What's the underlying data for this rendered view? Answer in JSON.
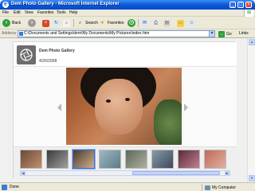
{
  "window": {
    "title": "Dem Photo Gallery - Microsoft Internet Explorer"
  },
  "menu": [
    {
      "label": "File"
    },
    {
      "label": "Edit"
    },
    {
      "label": "View"
    },
    {
      "label": "Favorites"
    },
    {
      "label": "Tools"
    },
    {
      "label": "Help"
    }
  ],
  "toolbar": {
    "back_label": "Back",
    "search_label": "Search",
    "favorites_label": "Favorites"
  },
  "address": {
    "label": "Address",
    "value": "C:\\Documents and Settings\\dem\\My Documents\\My Pictures\\index.htm",
    "go_label": "Go",
    "links_label": "Links"
  },
  "gallery": {
    "title": "Dem Photo Gallery",
    "date": "4/26/2008",
    "thumb_count_visible": 8,
    "selected_thumb": 3
  },
  "status": {
    "text": "Done",
    "zone": "My Computer"
  },
  "colors": {
    "title_bar": "#0a5bd8",
    "chrome": "#ece9d8",
    "accent": "#3a6dd8"
  },
  "icons": {
    "browser": "internet-explorer-icon",
    "back": "back-arrow-icon",
    "forward": "forward-arrow-icon",
    "stop": "stop-icon",
    "refresh": "refresh-icon",
    "home": "home-icon",
    "search": "search-icon",
    "favorites": "star-icon",
    "history": "history-icon",
    "mail": "mail-icon",
    "print": "print-icon"
  }
}
